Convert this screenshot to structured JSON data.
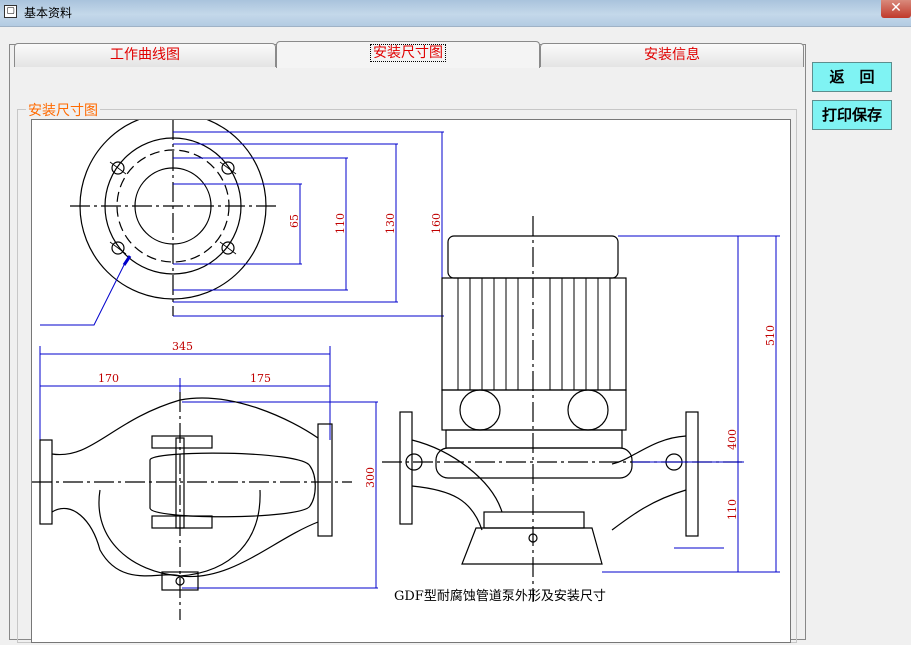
{
  "window": {
    "title": "基本资料",
    "close_glyph": "✕"
  },
  "tabs": [
    {
      "label": "工作曲线图",
      "active": false
    },
    {
      "label": "安装尺寸图",
      "active": true
    },
    {
      "label": "安装信息",
      "active": false
    }
  ],
  "group": {
    "title": "安装尺寸图"
  },
  "buttons": {
    "back": "返　回",
    "print_save": "打印保存"
  },
  "drawing": {
    "caption": "GDF型耐腐蚀管道泵外形及安装尺寸",
    "flange_dims": [
      "65",
      "110",
      "130",
      "160"
    ],
    "length_total": "345",
    "length_left": "170",
    "length_right": "175",
    "side_height": "300",
    "pump_height_total": "510",
    "pump_height_upper": "400",
    "pump_height_lower": "110"
  },
  "colors": {
    "tab_text": "#e00000",
    "group_title": "#ff6a00",
    "dimension": "#0000cc",
    "dim_text": "#c00000",
    "button_bg": "#7ff3f3"
  }
}
